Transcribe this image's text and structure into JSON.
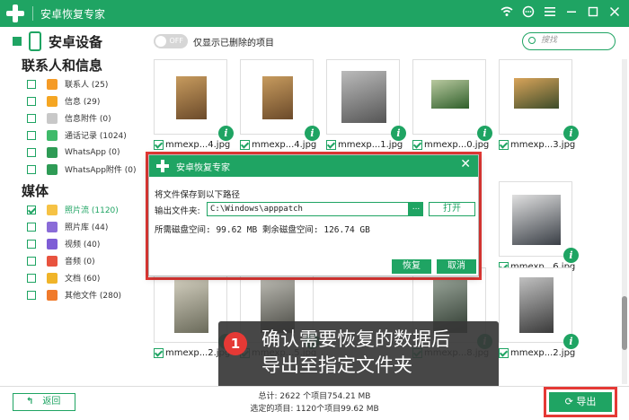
{
  "window": {
    "title": "安卓恢复专家",
    "controls": [
      "wifi-icon",
      "chat-icon",
      "menu-icon",
      "minimize-icon",
      "maximize-icon",
      "close-icon"
    ]
  },
  "sidebar": {
    "device": "安卓设备",
    "sections": [
      {
        "title": "联系人和信息",
        "items": [
          {
            "label": "联系人 (25)",
            "icon": "contact-icon",
            "color": "#f59b27",
            "checked": false
          },
          {
            "label": "信息 (29)",
            "icon": "message-icon",
            "color": "#f5a623",
            "checked": false
          },
          {
            "label": "信息附件 (0)",
            "icon": "attachment-icon",
            "color": "#c8c8c8",
            "checked": false
          },
          {
            "label": "通话记录 (1024)",
            "icon": "call-log-icon",
            "color": "#3fba6a",
            "checked": false
          },
          {
            "label": "WhatsApp (0)",
            "icon": "whatsapp-icon",
            "color": "#2e9b55",
            "checked": false
          },
          {
            "label": "WhatsApp附件 (0)",
            "icon": "whatsapp-attachment-icon",
            "color": "#2e9b55",
            "checked": false
          }
        ]
      },
      {
        "title": "媒体",
        "items": [
          {
            "label": "照片流 (1120)",
            "icon": "photo-stream-icon",
            "color": "#f6c244",
            "checked": true
          },
          {
            "label": "照片库 (44)",
            "icon": "photo-library-icon",
            "color": "#8a6cd8",
            "checked": false
          },
          {
            "label": "视频 (40)",
            "icon": "video-icon",
            "color": "#7e5dd6",
            "checked": false
          },
          {
            "label": "音频 (0)",
            "icon": "audio-icon",
            "color": "#e8533f",
            "checked": false
          },
          {
            "label": "文档 (60)",
            "icon": "document-icon",
            "color": "#f0b429",
            "checked": false
          },
          {
            "label": "其他文件 (280)",
            "icon": "other-files-icon",
            "color": "#f07a2b",
            "checked": false
          }
        ]
      }
    ]
  },
  "toolbar": {
    "toggle": "OFF",
    "toggle_label": "仅显示已删除的项目",
    "search_placeholder": "搜找"
  },
  "tiles": [
    {
      "caption": "mmexp...4.jpg",
      "colors": [
        "#6b4a2a",
        "#c79b5e"
      ]
    },
    {
      "caption": "mmexp...4.jpg",
      "colors": [
        "#6b4a2a",
        "#c79b5e"
      ]
    },
    {
      "caption": "mmexp...1.jpg",
      "colors": [
        "#555",
        "#bbb"
      ]
    },
    {
      "caption": "mmexp...0.jpg",
      "colors": [
        "#2f5f2a",
        "#b9c9a0"
      ]
    },
    {
      "caption": "mmexp...3.jpg",
      "colors": [
        "#3d4c2a",
        "#d9a45a"
      ]
    },
    {
      "caption": "mmexp...6.jpg",
      "colors": [
        "#3a3f46",
        "#e0e0e0"
      ]
    },
    {
      "caption": "mmexp...2.jpg",
      "colors": [
        "#6a6a5a",
        "#d4d0c0"
      ]
    },
    {
      "caption": "mmexp...5.jpg",
      "colors": [
        "#4a4a44",
        "#bdbcb4"
      ]
    },
    {
      "caption": "mmexp...8.jpg",
      "colors": [
        "#2f3a30",
        "#9aa69a"
      ]
    },
    {
      "caption": "mmexp...2.jpg",
      "colors": [
        "#3a3a3a",
        "#c0c0c0"
      ]
    }
  ],
  "dialog": {
    "title": "安卓恢复专家",
    "line1": "将文件保存到以下路径",
    "output_label": "输出文件夹:",
    "path": "C:\\Windows\\apppatch",
    "dots": "...",
    "open": "打开",
    "space_line": "所需磁盘空间:  99.62 MB 剩余磁盘空间:  126.74 GB",
    "recover": "恢复",
    "cancel": "取消"
  },
  "callout": {
    "number": "1",
    "line1": "确认需要恢复的数据后",
    "line2": "导出至指定文件夹"
  },
  "footer": {
    "back": "返回",
    "total": "总计: 2622 个项目754.21 MB",
    "selected": "选定的项目: 1120个项目99.62 MB",
    "export": "导出"
  }
}
